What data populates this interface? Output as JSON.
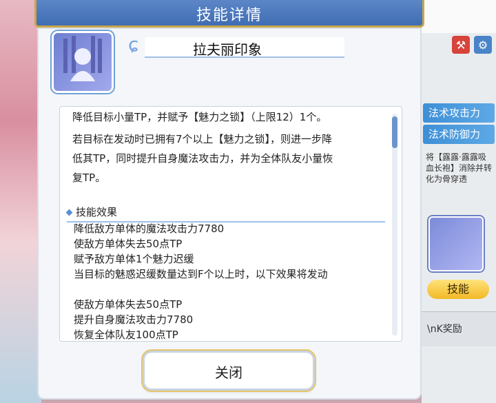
{
  "dialog": {
    "title": "技能详情",
    "close_label": "关闭"
  },
  "skill": {
    "name": "拉夫丽印象",
    "description_lines": [
      "降低目标小量TP，并赋予【魅力之锁】（上限12）1个。",
      " 若目标在发动时已拥有7个以上【魅力之锁】，则进一步降",
      "低其TP，同时提升自身魔法攻击力，并为全体队友小量恢",
      "复TP。"
    ],
    "effects_title": "技能效果",
    "effects": [
      "降低敌方单体的魔法攻击力7780",
      "使敌方单体失去50点TP",
      "赋予敌方单体1个魅力迟缓",
      "当目标的魅惑迟缓数量达到F个以上时，以下效果将发动",
      "",
      "使敌方单体失去50点TP",
      "提升自身魔法攻击力7780",
      "恢复全体队友100点TP"
    ]
  },
  "sidebar": {
    "labels": [
      "法术攻击力",
      "法术防御力"
    ],
    "note": "将【露露·露露吸血长袍】消除并转化为骨穿透",
    "skill_button": "技能",
    "reward_text": "\\nK奖励"
  }
}
